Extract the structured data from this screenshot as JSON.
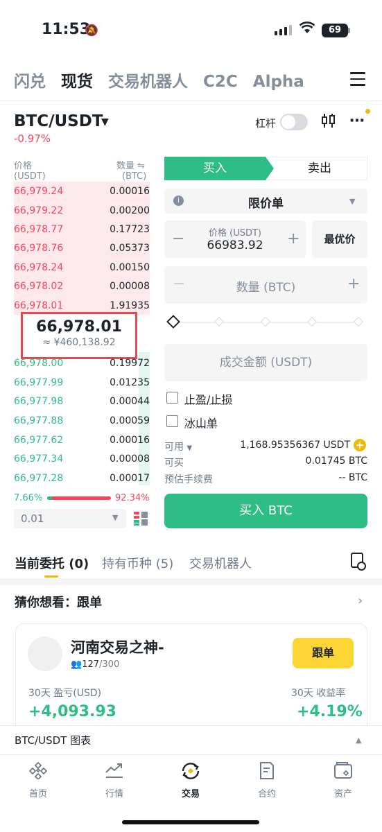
{
  "status_bar": {
    "time": "11:53",
    "battery": "69"
  },
  "top_tabs": [
    "闪兑",
    "现货",
    "交易机器人",
    "C2C",
    "Alpha"
  ],
  "pair": {
    "symbol": "BTC/USDT",
    "change": "-0.97%",
    "leverage_label": "杠杆"
  },
  "orderbook": {
    "price_header": "价格",
    "price_unit": "(USDT)",
    "qty_header": "数量",
    "qty_unit": "(BTC)",
    "asks": [
      {
        "price": "66,979.24",
        "qty": "0.00016"
      },
      {
        "price": "66,979.22",
        "qty": "0.00200"
      },
      {
        "price": "66,978.77",
        "qty": "0.17723"
      },
      {
        "price": "66,978.76",
        "qty": "0.05373"
      },
      {
        "price": "66,978.24",
        "qty": "0.00150"
      },
      {
        "price": "66,978.02",
        "qty": "0.00008"
      },
      {
        "price": "66,978.01",
        "qty": "1.91935"
      }
    ],
    "mid_price": "66,978.01",
    "mid_cny": "≈ ¥460,138.92",
    "bids": [
      {
        "price": "66,978.00",
        "qty": "0.19972"
      },
      {
        "price": "66,977.99",
        "qty": "0.01235"
      },
      {
        "price": "66,977.98",
        "qty": "0.00044"
      },
      {
        "price": "66,977.88",
        "qty": "0.00059"
      },
      {
        "price": "66,977.62",
        "qty": "0.00016"
      },
      {
        "price": "66,977.34",
        "qty": "0.00008"
      },
      {
        "price": "66,977.28",
        "qty": "0.00017"
      }
    ],
    "buy_ratio": "7.66%",
    "sell_ratio": "92.34%",
    "precision": "0.01"
  },
  "order_form": {
    "buy_tab": "买入",
    "sell_tab": "卖出",
    "order_type": "限价单",
    "price_label": "价格 (USDT)",
    "price_value": "66983.92",
    "best_price_button": "最优价",
    "qty_placeholder": "数量 (BTC)",
    "total_placeholder": "成交金额 (USDT)",
    "tp_sl_label": "止盈/止损",
    "iceberg_label": "冰山单",
    "available_label": "可用",
    "available_value": "1,168.95356367 USDT",
    "can_buy_label": "可买",
    "can_buy_value": "0.01745 BTC",
    "fee_label": "预估手续费",
    "fee_value": "-- BTC",
    "submit_button": "买入 BTC"
  },
  "order_tabs": {
    "open_orders": "当前委托 (0)",
    "holdings": "持有币种 (5)",
    "bots": "交易机器人"
  },
  "recommend": {
    "title": "猜你想看：跟单",
    "trader_name": "河南交易之神-",
    "followers": "127",
    "followers_max": "/300",
    "follow_button": "跟单",
    "pnl_label": "30天 盈亏(USD)",
    "pnl_value": "+4,093.93",
    "roi_label": "30天 收益率",
    "roi_value": "+4.19%"
  },
  "chart_bar": {
    "label": "BTC/USDT 图表"
  },
  "bottom_nav": [
    {
      "label": "首页",
      "icon": "home-icon"
    },
    {
      "label": "行情",
      "icon": "markets-icon"
    },
    {
      "label": "交易",
      "icon": "trade-icon"
    },
    {
      "label": "合约",
      "icon": "futures-icon"
    },
    {
      "label": "资产",
      "icon": "wallet-icon"
    }
  ]
}
